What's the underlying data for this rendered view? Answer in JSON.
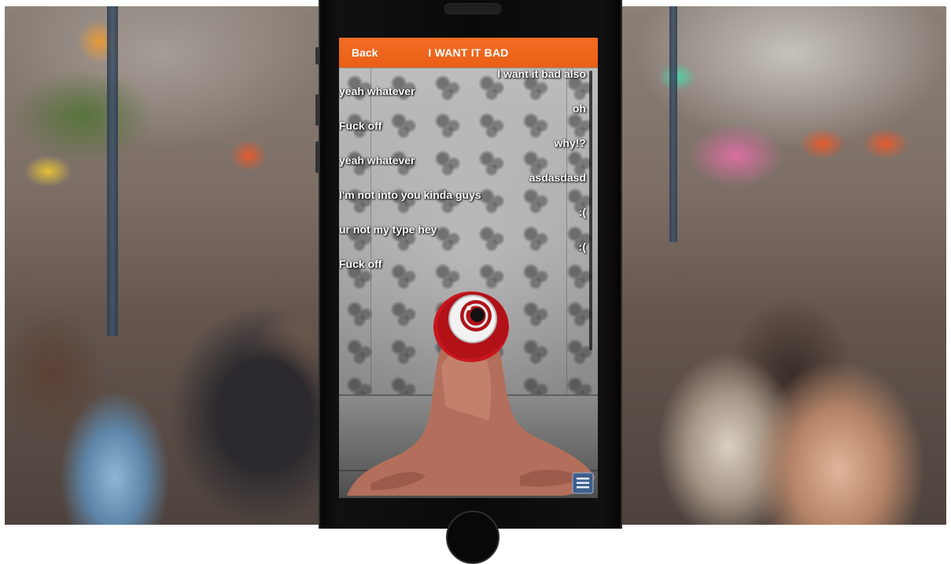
{
  "header": {
    "back_label": "Back",
    "title": "I WANT IT BAD"
  },
  "chat": {
    "messages": [
      {
        "side": "right",
        "text": "I want it bad also"
      },
      {
        "side": "left",
        "text": "yeah whatever"
      },
      {
        "side": "right",
        "text": "oh"
      },
      {
        "side": "left",
        "text": "Fuck off"
      },
      {
        "side": "right",
        "text": "why!?"
      },
      {
        "side": "left",
        "text": "yeah whatever"
      },
      {
        "side": "right",
        "text": "asdasdasd"
      },
      {
        "side": "left",
        "text": "I'm not into you kinda guys"
      },
      {
        "side": "right",
        "text": ":("
      },
      {
        "side": "left",
        "text": "ur not my type hey"
      },
      {
        "side": "right",
        "text": ":("
      },
      {
        "side": "left",
        "text": "Fuck off"
      }
    ]
  },
  "icons": {
    "menu": "menu-list-icon",
    "creature": "eyeball-creature-icon"
  },
  "colors": {
    "header_bg": "#f0651c",
    "header_text": "#ffffff",
    "message_text": "#ffffff",
    "creature_skin": "#b7735f",
    "eye_red": "#c8161d",
    "menu_button": "#3e5f8e"
  }
}
